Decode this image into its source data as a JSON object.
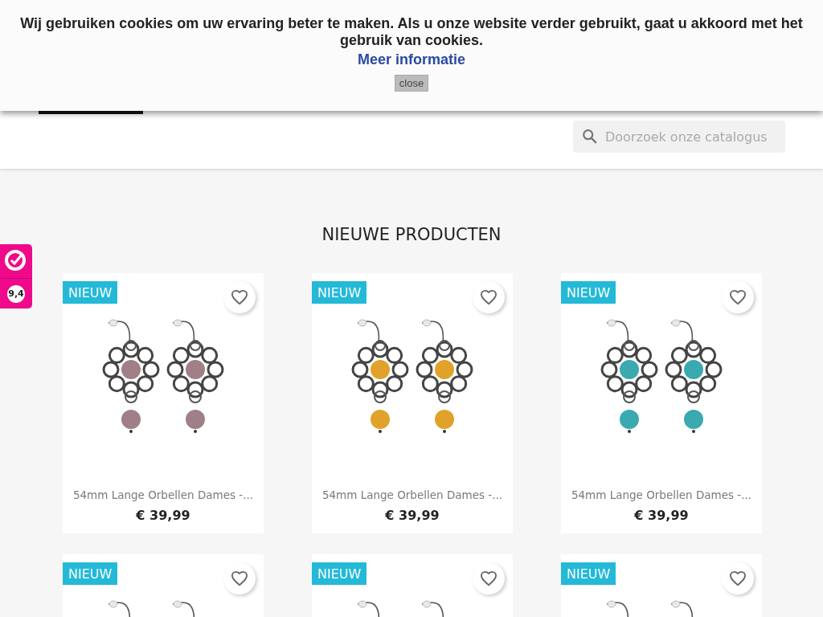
{
  "cookie_banner": {
    "message": "Wij gebruiken cookies om uw ervaring beter te maken. Als u onze website verder gebruikt, gaat u akkoord met het gebruik van cookies.",
    "link": "Meer informatie",
    "close_button": "close"
  },
  "header": {
    "search": {
      "placeholder": "Doorzoek onze catalogus"
    }
  },
  "rating_widget": {
    "score": "9,4"
  },
  "section_title": "NIEUWE PRODUCTEN",
  "products": [
    {
      "badge": "NIEUW",
      "name": "54mm Lange Orbellen Dames -...",
      "price": "€ 39,99",
      "color": "#a07f86"
    },
    {
      "badge": "NIEUW",
      "name": "54mm Lange Orbellen Dames -...",
      "price": "€ 39,99",
      "color": "#e0a22a"
    },
    {
      "badge": "NIEUW",
      "name": "54mm Lange Orbellen Dames -...",
      "price": "€ 39,99",
      "color": "#3aa9b0"
    },
    {
      "badge": "NIEUW"
    },
    {
      "badge": "NIEUW"
    },
    {
      "badge": "NIEUW"
    }
  ]
}
